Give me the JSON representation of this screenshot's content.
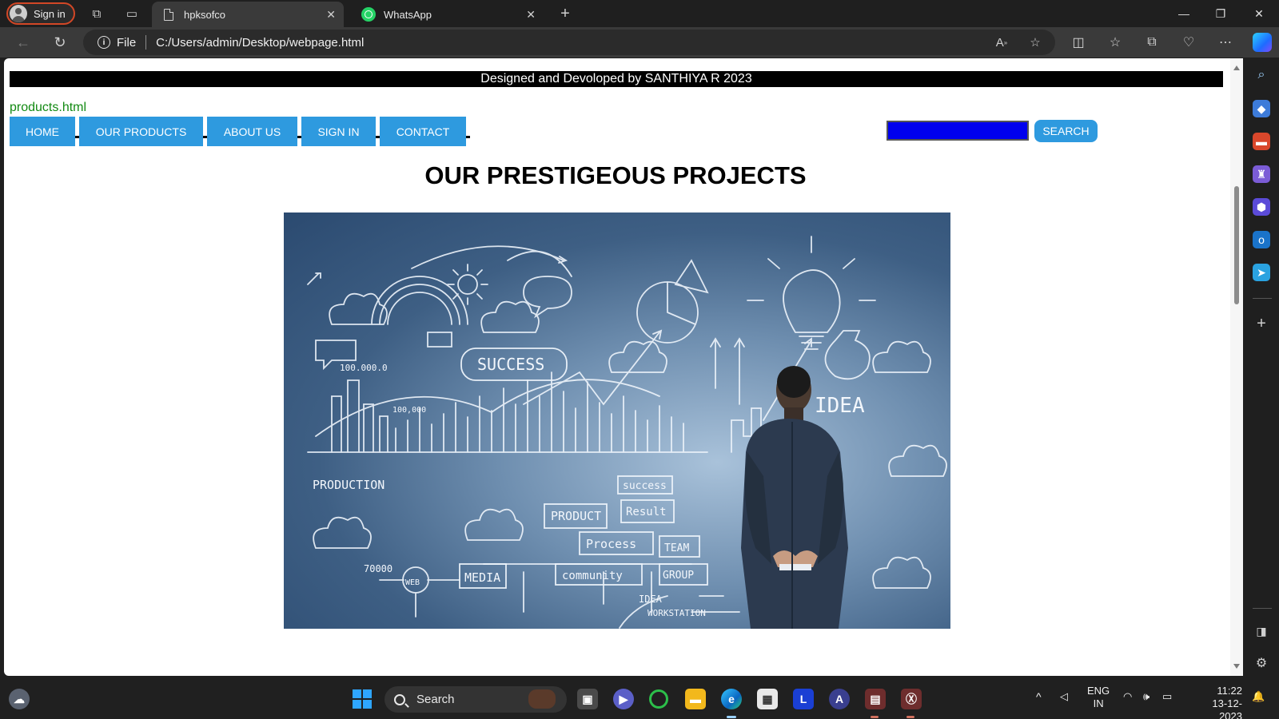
{
  "browser": {
    "profile_label": "Sign in",
    "tabs": [
      {
        "label": "hpksofco",
        "active": true
      },
      {
        "label": "WhatsApp",
        "active": false
      }
    ],
    "address_scheme": "File",
    "address_url": "C:/Users/admin/Desktop/webpage.html"
  },
  "page": {
    "banner": "Designed and Devoloped by SANTHIYA R 2023",
    "products_link": "products.html",
    "nav": [
      "HOME",
      "OUR PRODUCTS",
      "ABOUT US",
      "SIGN IN",
      "CONTACT"
    ],
    "search_button": "SEARCH",
    "heading": "OUR PRESTIGEOUS PROJECTS",
    "hero_words": [
      "SUCCESS",
      "IDEA",
      "PRODUCTION",
      "PRODUCT",
      "Result",
      "Process",
      "TEAM",
      "community",
      "GROUP",
      "MEDIA",
      "WEB",
      "success",
      "IDEA",
      "WORKSTATION",
      "100.000.0",
      "100,000",
      "70000"
    ]
  },
  "taskbar": {
    "search_label": "Search",
    "lang_top": "ENG",
    "lang_bottom": "IN",
    "time": "11:22",
    "date": "13-12-2023"
  },
  "colors": {
    "nav_blue": "#2e9adf",
    "search_input_fill": "#0000ee",
    "link_green": "#138a13"
  }
}
